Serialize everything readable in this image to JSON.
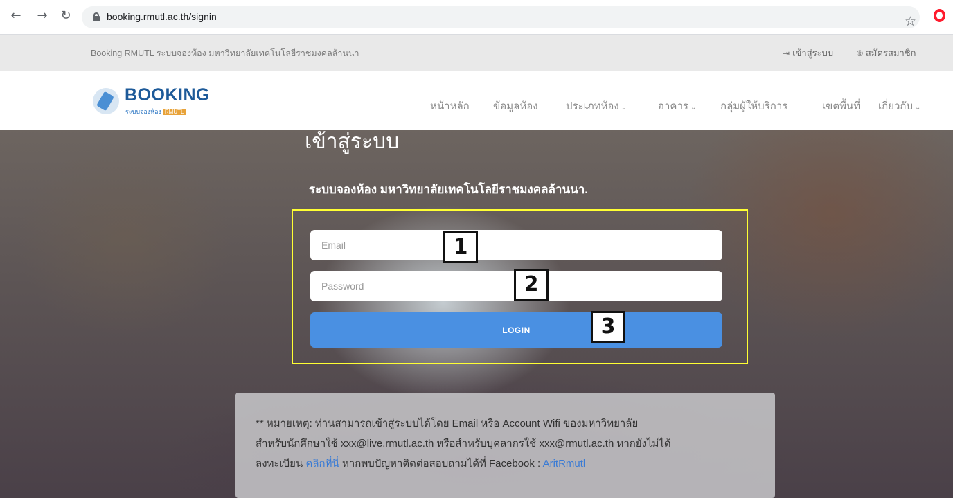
{
  "browser": {
    "url": "booking.rmutl.ac.th/signin",
    "back_icon": "arrow-left-icon",
    "forward_icon": "arrow-right-icon",
    "reload_icon": "reload-icon",
    "bookmark_icon": "star-icon",
    "extension_icon": "opera-icon"
  },
  "infobar": {
    "title": "Booking RMUTL ระบบจองห้อง มหาวิทยาลัยเทคโนโลยีราชมงคลล้านนา",
    "login_label": "เข้าสู่ระบบ",
    "register_label": "สมัครสมาชิก"
  },
  "logo": {
    "word": "BOOKING",
    "sub": "ระบบจองห้อง",
    "badge": "RMUTL"
  },
  "nav": {
    "home": "หน้าหลัก",
    "rooms": "ข้อมูลห้อง",
    "room_types": "ประเภทห้อง",
    "buildings": "อาคาร",
    "providers": "กลุ่มผู้ให้บริการ",
    "areas": "เขตพื้นที่",
    "about": "เกี่ยวกับ"
  },
  "hero": {
    "title": "เข้าสู่ระบบ",
    "subtitle": "ระบบจองห้อง มหาวิทยาลัยเทคโนโลยีราชมงคลล้านนา."
  },
  "form": {
    "email_placeholder": "Email",
    "password_placeholder": "Password",
    "login_label": "LOGIN",
    "highlight_color": "#ffff33",
    "button_color": "#4a90e2"
  },
  "markers": [
    "1",
    "2",
    "3"
  ],
  "note": {
    "line1": "** หมายเหตุ: ท่านสามารถเข้าสู่ระบบได้โดย Email หรือ Account Wifi ของมหาวิทยาลัย",
    "line2": "สำหรับนักศึกษาใช้ xxx@live.rmutl.ac.th หรือสำหรับบุคลากรใช้ xxx@rmutl.ac.th หากยังไม่ได้",
    "line3_prefix": "ลงทะเบียน",
    "register_link": "คลิกที่นี่",
    "line3_middle": "หากพบปัญหาติดต่อสอบถามได้ที่ Facebook :",
    "facebook_link": "AritRmutl"
  }
}
